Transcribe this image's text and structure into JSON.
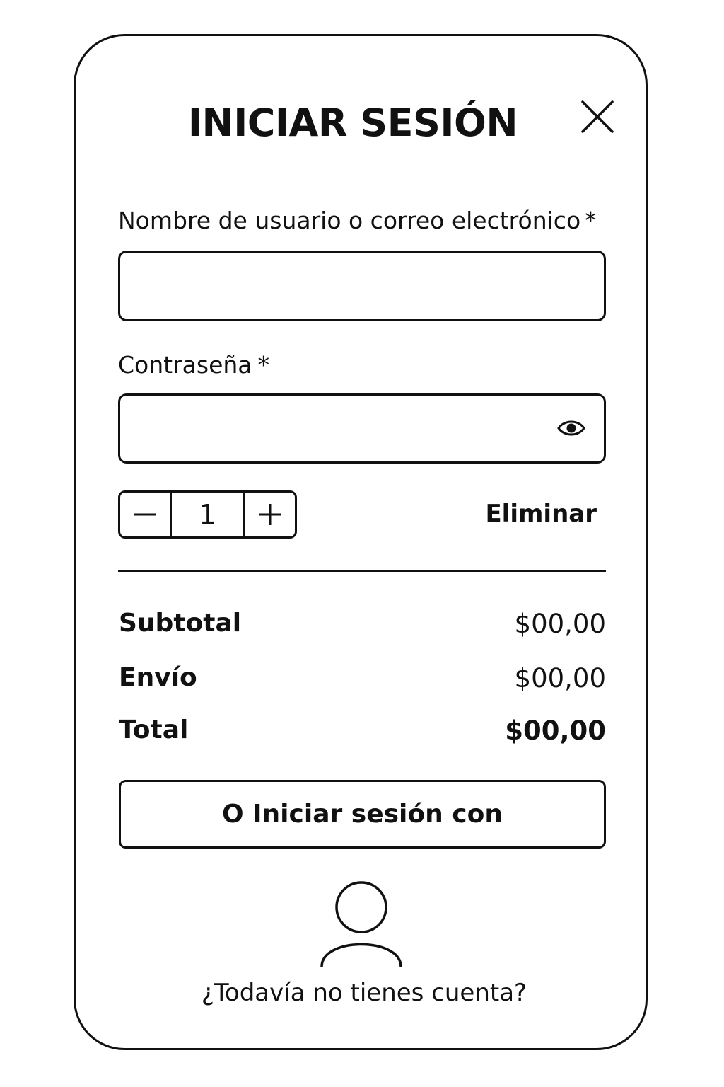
{
  "dialog": {
    "title": "INICIAR SESIÓN",
    "close_icon": "close-icon"
  },
  "form": {
    "username_label": "Nombre de usuario o correo electrónico",
    "username_required": "*",
    "username_value": "",
    "password_label": "Contraseña",
    "password_required": "*",
    "password_value": "",
    "password_toggle_icon": "eye-icon"
  },
  "cart": {
    "quantity": "1",
    "minus_icon": "minus-icon",
    "plus_icon": "plus-icon",
    "remove_label": "Eliminar"
  },
  "summary": {
    "subtotal_label": "Subtotal",
    "subtotal_value": "$00,00",
    "shipping_label": "Envío",
    "shipping_value": "$00,00",
    "total_label": "Total",
    "total_value": "$00,00"
  },
  "social": {
    "button_label": "O Iniciar sesión con",
    "avatar_icon": "user-icon"
  },
  "footer": {
    "signup_text": "¿Todavía no tienes cuenta?"
  },
  "colors": {
    "stroke": "#111111",
    "background": "#ffffff"
  }
}
